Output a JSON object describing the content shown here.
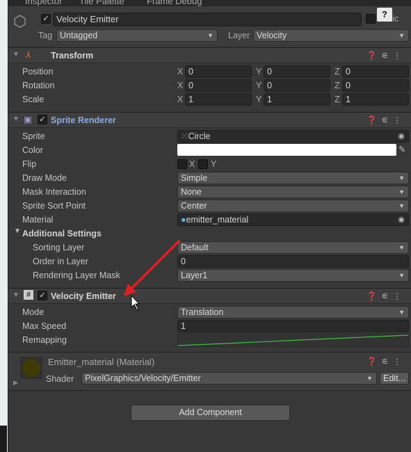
{
  "tabs": [
    "Inspector",
    "Tile Palette",
    "Frame Debug"
  ],
  "object": {
    "name": "Velocity Emitter",
    "active": true,
    "static_label": "Static",
    "tag_label": "Tag",
    "tag": "Untagged",
    "layer_label": "Layer",
    "layer": "Velocity"
  },
  "transform": {
    "title": "Transform",
    "rows": [
      {
        "label": "Position",
        "x": "0",
        "y": "0",
        "z": "0"
      },
      {
        "label": "Rotation",
        "x": "0",
        "y": "0",
        "z": "0"
      },
      {
        "label": "Scale",
        "x": "1",
        "y": "1",
        "z": "1"
      }
    ],
    "axes": [
      "X",
      "Y",
      "Z"
    ]
  },
  "sprite_renderer": {
    "title": "Sprite Renderer",
    "enabled": true,
    "sprite_label": "Sprite",
    "sprite": "Circle",
    "color_label": "Color",
    "color": "#ffffff",
    "flip_label": "Flip",
    "flip_x": "X",
    "flip_y": "Y",
    "draw_mode_label": "Draw Mode",
    "draw_mode": "Simple",
    "mask_label": "Mask Interaction",
    "mask": "None",
    "sort_point_label": "Sprite Sort Point",
    "sort_point": "Center",
    "material_label": "Material",
    "material": "emitter_material",
    "additional": "Additional Settings",
    "sorting_layer_label": "Sorting Layer",
    "sorting_layer": "Default",
    "order_label": "Order in Layer",
    "order": "0",
    "rendering_mask_label": "Rendering Layer Mask",
    "rendering_mask": "Layer1"
  },
  "velocity_emitter": {
    "title": "Velocity Emitter",
    "enabled": true,
    "mode_label": "Mode",
    "mode": "Translation",
    "max_speed_label": "Max Speed",
    "max_speed": "1",
    "remapping_label": "Remapping",
    "curve_color": "#3ec33e"
  },
  "material": {
    "title": "Emitter_material (Material)",
    "shader_label": "Shader",
    "shader": "PixelGraphics/Velocity/Emitter",
    "edit": "Edit...",
    "preview_color": "#3f3c05"
  },
  "add_component": "Add Component",
  "annotation_color": "#e02020"
}
